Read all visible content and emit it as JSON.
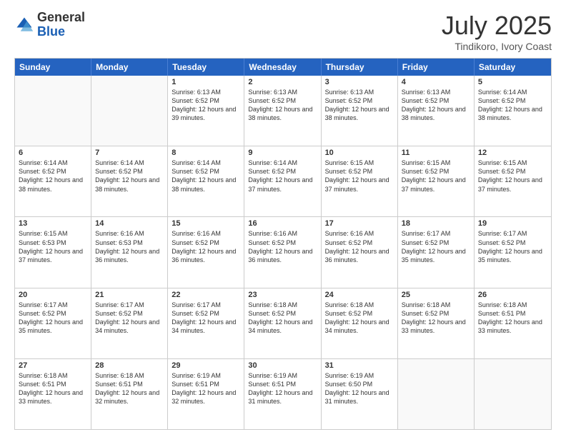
{
  "logo": {
    "general": "General",
    "blue": "Blue"
  },
  "header": {
    "month": "July 2025",
    "location": "Tindikoro, Ivory Coast"
  },
  "weekdays": [
    "Sunday",
    "Monday",
    "Tuesday",
    "Wednesday",
    "Thursday",
    "Friday",
    "Saturday"
  ],
  "weeks": [
    [
      {
        "day": "",
        "empty": true
      },
      {
        "day": "",
        "empty": true
      },
      {
        "day": "1",
        "sunrise": "Sunrise: 6:13 AM",
        "sunset": "Sunset: 6:52 PM",
        "daylight": "Daylight: 12 hours and 39 minutes."
      },
      {
        "day": "2",
        "sunrise": "Sunrise: 6:13 AM",
        "sunset": "Sunset: 6:52 PM",
        "daylight": "Daylight: 12 hours and 38 minutes."
      },
      {
        "day": "3",
        "sunrise": "Sunrise: 6:13 AM",
        "sunset": "Sunset: 6:52 PM",
        "daylight": "Daylight: 12 hours and 38 minutes."
      },
      {
        "day": "4",
        "sunrise": "Sunrise: 6:13 AM",
        "sunset": "Sunset: 6:52 PM",
        "daylight": "Daylight: 12 hours and 38 minutes."
      },
      {
        "day": "5",
        "sunrise": "Sunrise: 6:14 AM",
        "sunset": "Sunset: 6:52 PM",
        "daylight": "Daylight: 12 hours and 38 minutes."
      }
    ],
    [
      {
        "day": "6",
        "sunrise": "Sunrise: 6:14 AM",
        "sunset": "Sunset: 6:52 PM",
        "daylight": "Daylight: 12 hours and 38 minutes."
      },
      {
        "day": "7",
        "sunrise": "Sunrise: 6:14 AM",
        "sunset": "Sunset: 6:52 PM",
        "daylight": "Daylight: 12 hours and 38 minutes."
      },
      {
        "day": "8",
        "sunrise": "Sunrise: 6:14 AM",
        "sunset": "Sunset: 6:52 PM",
        "daylight": "Daylight: 12 hours and 38 minutes."
      },
      {
        "day": "9",
        "sunrise": "Sunrise: 6:14 AM",
        "sunset": "Sunset: 6:52 PM",
        "daylight": "Daylight: 12 hours and 37 minutes."
      },
      {
        "day": "10",
        "sunrise": "Sunrise: 6:15 AM",
        "sunset": "Sunset: 6:52 PM",
        "daylight": "Daylight: 12 hours and 37 minutes."
      },
      {
        "day": "11",
        "sunrise": "Sunrise: 6:15 AM",
        "sunset": "Sunset: 6:52 PM",
        "daylight": "Daylight: 12 hours and 37 minutes."
      },
      {
        "day": "12",
        "sunrise": "Sunrise: 6:15 AM",
        "sunset": "Sunset: 6:52 PM",
        "daylight": "Daylight: 12 hours and 37 minutes."
      }
    ],
    [
      {
        "day": "13",
        "sunrise": "Sunrise: 6:15 AM",
        "sunset": "Sunset: 6:53 PM",
        "daylight": "Daylight: 12 hours and 37 minutes."
      },
      {
        "day": "14",
        "sunrise": "Sunrise: 6:16 AM",
        "sunset": "Sunset: 6:53 PM",
        "daylight": "Daylight: 12 hours and 36 minutes."
      },
      {
        "day": "15",
        "sunrise": "Sunrise: 6:16 AM",
        "sunset": "Sunset: 6:52 PM",
        "daylight": "Daylight: 12 hours and 36 minutes."
      },
      {
        "day": "16",
        "sunrise": "Sunrise: 6:16 AM",
        "sunset": "Sunset: 6:52 PM",
        "daylight": "Daylight: 12 hours and 36 minutes."
      },
      {
        "day": "17",
        "sunrise": "Sunrise: 6:16 AM",
        "sunset": "Sunset: 6:52 PM",
        "daylight": "Daylight: 12 hours and 36 minutes."
      },
      {
        "day": "18",
        "sunrise": "Sunrise: 6:17 AM",
        "sunset": "Sunset: 6:52 PM",
        "daylight": "Daylight: 12 hours and 35 minutes."
      },
      {
        "day": "19",
        "sunrise": "Sunrise: 6:17 AM",
        "sunset": "Sunset: 6:52 PM",
        "daylight": "Daylight: 12 hours and 35 minutes."
      }
    ],
    [
      {
        "day": "20",
        "sunrise": "Sunrise: 6:17 AM",
        "sunset": "Sunset: 6:52 PM",
        "daylight": "Daylight: 12 hours and 35 minutes."
      },
      {
        "day": "21",
        "sunrise": "Sunrise: 6:17 AM",
        "sunset": "Sunset: 6:52 PM",
        "daylight": "Daylight: 12 hours and 34 minutes."
      },
      {
        "day": "22",
        "sunrise": "Sunrise: 6:17 AM",
        "sunset": "Sunset: 6:52 PM",
        "daylight": "Daylight: 12 hours and 34 minutes."
      },
      {
        "day": "23",
        "sunrise": "Sunrise: 6:18 AM",
        "sunset": "Sunset: 6:52 PM",
        "daylight": "Daylight: 12 hours and 34 minutes."
      },
      {
        "day": "24",
        "sunrise": "Sunrise: 6:18 AM",
        "sunset": "Sunset: 6:52 PM",
        "daylight": "Daylight: 12 hours and 34 minutes."
      },
      {
        "day": "25",
        "sunrise": "Sunrise: 6:18 AM",
        "sunset": "Sunset: 6:52 PM",
        "daylight": "Daylight: 12 hours and 33 minutes."
      },
      {
        "day": "26",
        "sunrise": "Sunrise: 6:18 AM",
        "sunset": "Sunset: 6:51 PM",
        "daylight": "Daylight: 12 hours and 33 minutes."
      }
    ],
    [
      {
        "day": "27",
        "sunrise": "Sunrise: 6:18 AM",
        "sunset": "Sunset: 6:51 PM",
        "daylight": "Daylight: 12 hours and 33 minutes."
      },
      {
        "day": "28",
        "sunrise": "Sunrise: 6:18 AM",
        "sunset": "Sunset: 6:51 PM",
        "daylight": "Daylight: 12 hours and 32 minutes."
      },
      {
        "day": "29",
        "sunrise": "Sunrise: 6:19 AM",
        "sunset": "Sunset: 6:51 PM",
        "daylight": "Daylight: 12 hours and 32 minutes."
      },
      {
        "day": "30",
        "sunrise": "Sunrise: 6:19 AM",
        "sunset": "Sunset: 6:51 PM",
        "daylight": "Daylight: 12 hours and 31 minutes."
      },
      {
        "day": "31",
        "sunrise": "Sunrise: 6:19 AM",
        "sunset": "Sunset: 6:50 PM",
        "daylight": "Daylight: 12 hours and 31 minutes."
      },
      {
        "day": "",
        "empty": true
      },
      {
        "day": "",
        "empty": true
      }
    ]
  ]
}
